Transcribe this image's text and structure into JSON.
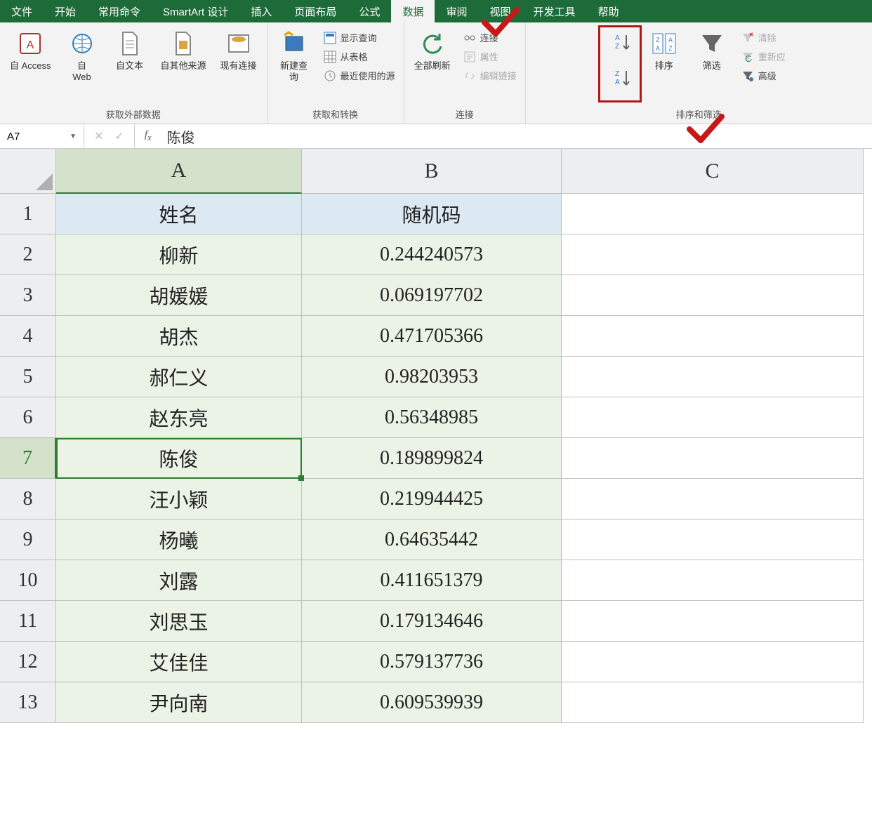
{
  "menu": {
    "tabs": [
      "文件",
      "开始",
      "常用命令",
      "SmartArt 设计",
      "插入",
      "页面布局",
      "公式",
      "数据",
      "审阅",
      "视图",
      "开发工具",
      "帮助"
    ],
    "active_index": 7
  },
  "ribbon": {
    "groups": {
      "external": {
        "label": "获取外部数据",
        "items": {
          "access": "自 Access",
          "web": "自\nWeb",
          "text": "自文本",
          "other": "自其他来源",
          "existing": "现有连接"
        }
      },
      "transform": {
        "label": "获取和转换",
        "newquery": "新建查\n询",
        "showquery": "显示查询",
        "fromtable": "从表格",
        "recent": "最近使用的源"
      },
      "connections": {
        "label": "连接",
        "refresh": "全部刷新",
        "conn": "连接",
        "prop": "属性",
        "editlink": "编辑链接"
      },
      "sortfilter": {
        "label": "排序和筛选",
        "sort": "排序",
        "filter": "筛选",
        "clear": "清除",
        "reapply": "重新应",
        "advanced": "高级"
      }
    }
  },
  "formula_bar": {
    "namebox": "A7",
    "value": "陈俊"
  },
  "sheet": {
    "columns": [
      "A",
      "B",
      "C"
    ],
    "headers": {
      "A": "姓名",
      "B": "随机码"
    },
    "rows": [
      {
        "n": 1,
        "A": "姓名",
        "B": "随机码",
        "header": true
      },
      {
        "n": 2,
        "A": "柳新",
        "B": "0.244240573"
      },
      {
        "n": 3,
        "A": "胡媛媛",
        "B": "0.069197702"
      },
      {
        "n": 4,
        "A": "胡杰",
        "B": "0.471705366"
      },
      {
        "n": 5,
        "A": "郝仁义",
        "B": "0.98203953"
      },
      {
        "n": 6,
        "A": "赵东亮",
        "B": "0.56348985"
      },
      {
        "n": 7,
        "A": "陈俊",
        "B": "0.189899824",
        "selected": true
      },
      {
        "n": 8,
        "A": "汪小颖",
        "B": "0.219944425"
      },
      {
        "n": 9,
        "A": "杨曦",
        "B": "0.64635442"
      },
      {
        "n": 10,
        "A": "刘露",
        "B": "0.411651379"
      },
      {
        "n": 11,
        "A": "刘思玉",
        "B": "0.179134646"
      },
      {
        "n": 12,
        "A": "艾佳佳",
        "B": "0.579137736"
      },
      {
        "n": 13,
        "A": "尹向南",
        "B": "0.609539939"
      }
    ],
    "selected_cell": "A7"
  }
}
